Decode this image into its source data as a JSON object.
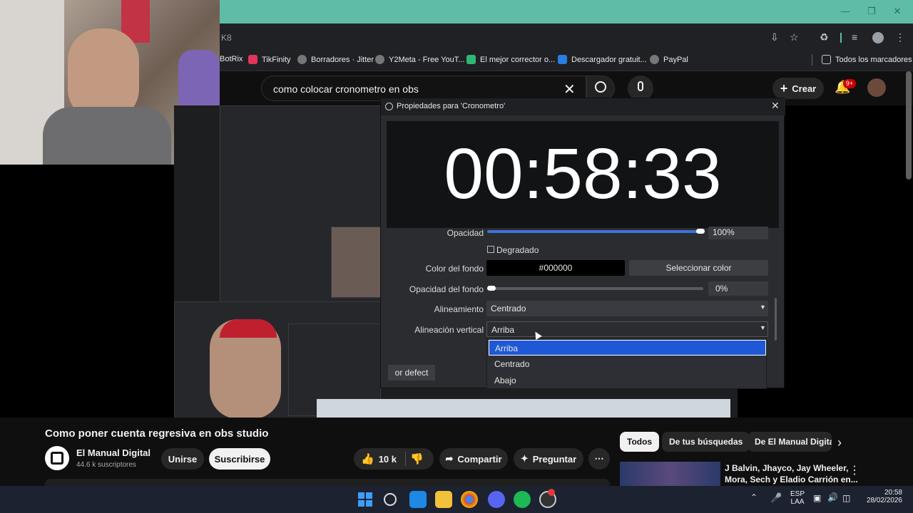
{
  "browser": {
    "url_fragment": "K8",
    "bookmarks": [
      {
        "label": "BotRix",
        "color": "#444"
      },
      {
        "label": "TikFinity",
        "color": "#e2355a"
      },
      {
        "label": "Borradores · Jitter",
        "color": "#888"
      },
      {
        "label": "Y2Meta - Free YouT...",
        "color": "#888"
      },
      {
        "label": "El mejor corrector o...",
        "color": "#2eb872"
      },
      {
        "label": "Descargador gratuit...",
        "color": "#2a7de1"
      },
      {
        "label": "PayPal",
        "color": "#888"
      }
    ],
    "all_bookmarks": "Todos los marcadores"
  },
  "youtube": {
    "search_value": "como colocar cronometro en obs",
    "create_label": "Crear",
    "notif_count": "9+",
    "video_title": "Como poner cuenta regresiva en obs studio",
    "channel_name": "El Manual Digital",
    "subscribers": "44.6 k suscriptores",
    "join_label": "Unirse",
    "subscribe_label": "Suscribirse",
    "likes": "10 k",
    "share_label": "Compartir",
    "ask_label": "Preguntar",
    "chips": [
      "Todos",
      "De tus búsquedas",
      "De El Manual Digita"
    ],
    "rec_title_1": "J Balvin, Jhayco, Jay Wheeler,",
    "rec_title_2": "Mora, Sech y Eladio Carrión en..."
  },
  "obs": {
    "dialog_title": "Propiedades para 'Cronometro'",
    "timer": "00:58:33",
    "opacity_label": "Opacidad",
    "opacity_value": "100%",
    "gradient_label": "Degradado",
    "bg_color_label": "Color del fondo",
    "bg_color_value": "#000000",
    "select_color": "Seleccionar color",
    "bg_opacity_label": "Opacidad del fondo",
    "bg_opacity_value": "0%",
    "align_label": "Alineamiento",
    "align_value": "Centrado",
    "valign_label": "Alineación vertical",
    "valign_value": "Arriba",
    "valign_options": [
      "Arriba",
      "Centrado",
      "Abajo"
    ],
    "defaults_button": "or defect"
  },
  "taskbar": {
    "lang_1": "ESP",
    "lang_2": "LAA",
    "time": "20:58",
    "date": "28/02/2026"
  }
}
